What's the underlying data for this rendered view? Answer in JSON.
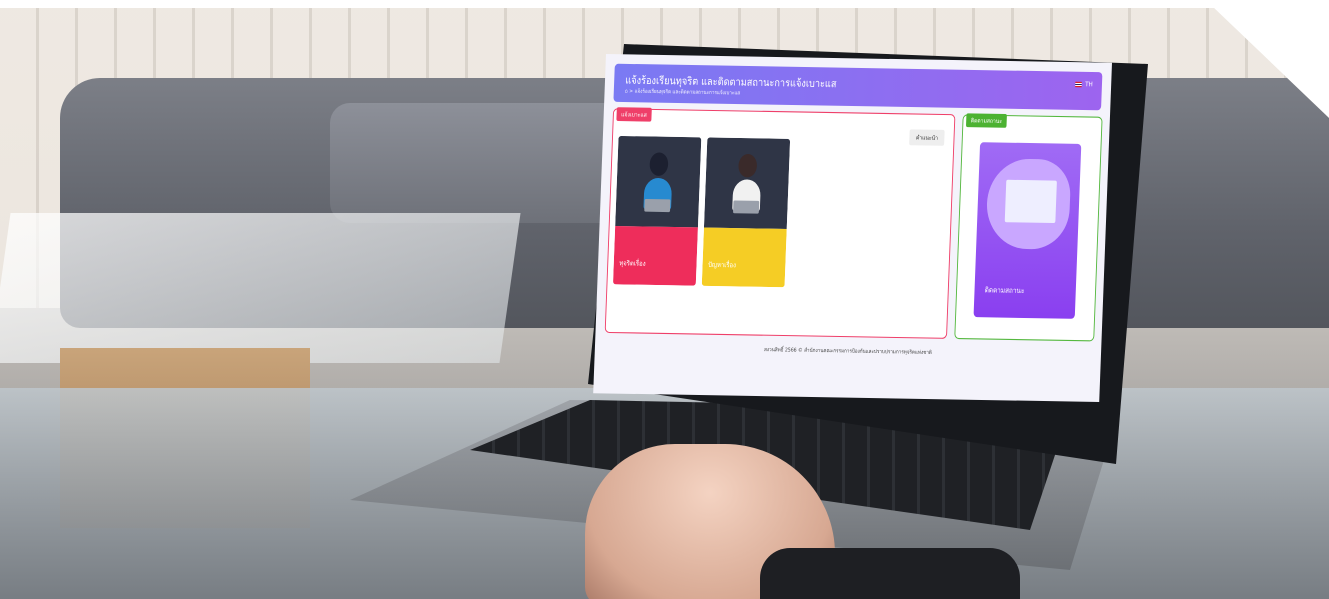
{
  "header": {
    "title": "แจ้งร้องเรียนทุจริต และติดตามสถานะการแจ้งเบาะแส",
    "breadcrumb": "⌂ > แจ้งร้องเรียนทุจริต และติดตามสถานะการแจ้งเบาะแส",
    "language": "TH"
  },
  "left_panel": {
    "tag": "แจ้งเบาะแส",
    "help_button": "คำแนะนำ",
    "cards": [
      {
        "label": "ทุจริตเรื่อง"
      },
      {
        "label": "ปัญหาเรื่อง"
      }
    ]
  },
  "right_panel": {
    "tag": "ติดตามสถานะ",
    "card_label": "ติดตามสถานะ"
  },
  "footer": {
    "text": "สงวนสิทธิ์ 2566 © สำนักงานคณะกรรมการป้องกันและปราบปรามการทุจริตแห่งชาติ"
  },
  "colors": {
    "header_gradient_start": "#7a7af3",
    "header_gradient_end": "#9d64ef",
    "report_accent": "#ef3f69",
    "problem_accent": "#f5cd25",
    "track_accent": "#4cb232",
    "track_card": "#8a3ff0"
  }
}
